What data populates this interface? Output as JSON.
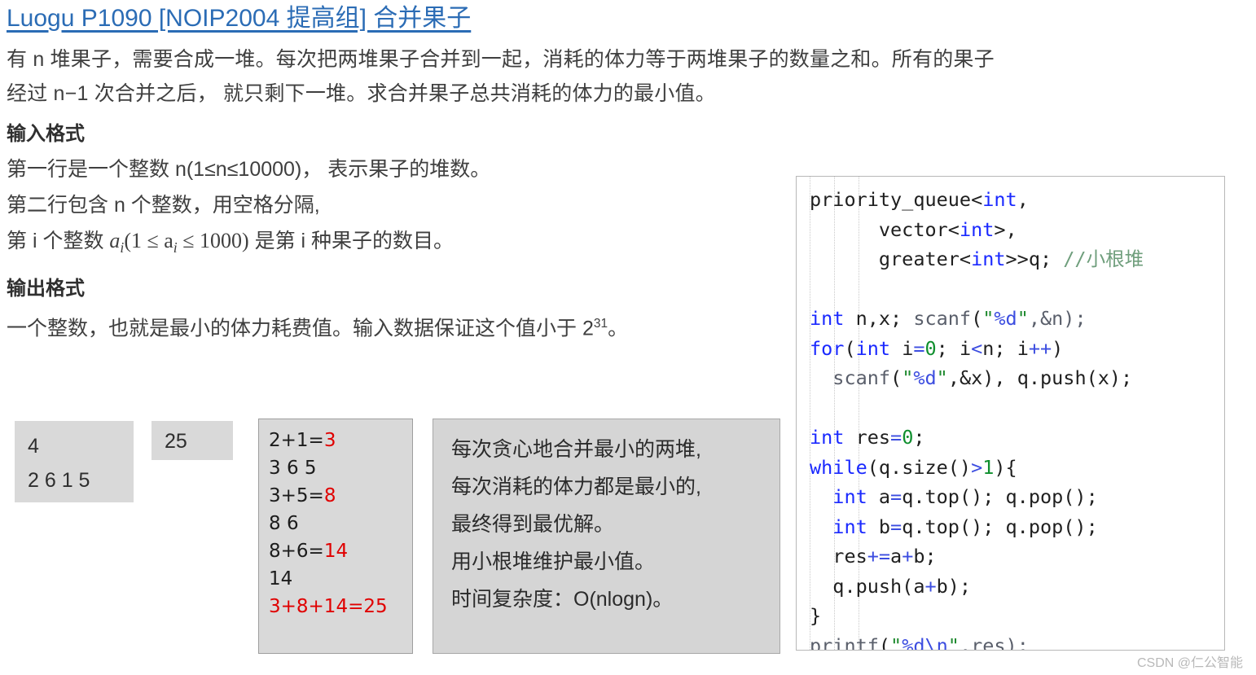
{
  "title": {
    "text": "Luogu P1090 [NOIP2004 提高组] 合并果子",
    "color": "#2b6cb5"
  },
  "problem": {
    "description_line1": "有 n 堆果子，需要合成一堆。每次把两堆果子合并到一起，消耗的体力等于两堆果子的数量之和。所有的果子",
    "description_line2": "经过 n−1 次合并之后， 就只剩下一堆。求合并果子总共消耗的体力的最小值。",
    "input_heading": "输入格式",
    "input_line1": "第一行是一个整数 n(1≤n≤10000)， 表示果子的堆数。",
    "input_line2": "第二行包含 n 个整数，用空格分隔,",
    "input_line3_pre": "第 i 个整数 ",
    "input_line3_math_a": "a",
    "input_line3_math_sub": "i",
    "input_line3_math_range": "(1 ≤ a",
    "input_line3_math_sub2": "i",
    "input_line3_math_range2": " ≤ 1000)",
    "input_line3_post": " 是第 i 种果子的数目。",
    "output_heading": "输出格式",
    "output_line_pre": "一个整数，也就是最小的体力耗费值。输入数据保证这个值小于 2",
    "output_line_sup": "31",
    "output_line_post": "。"
  },
  "samples": {
    "input_n": "4",
    "input_values": "2 6 1 5",
    "output_value": "25"
  },
  "trace": {
    "lines": [
      {
        "plain": "2+1=",
        "red": "3"
      },
      {
        "plain": "3 6 5",
        "red": ""
      },
      {
        "plain": "3+5=",
        "red": "8"
      },
      {
        "plain": "8 6",
        "red": ""
      },
      {
        "plain": "8+6=",
        "red": "14"
      },
      {
        "plain": "14",
        "red": ""
      },
      {
        "plain": "",
        "red": "3+8+14=25",
        "all_red": true
      }
    ]
  },
  "note": {
    "lines": [
      "每次贪心地合并最小的两堆,",
      "每次消耗的体力都是最小的,",
      "最终得到最优解。",
      "用小根堆维护最小值。",
      "时间复杂度：O(nlogn)。"
    ]
  },
  "code": {
    "lines": [
      [
        {
          "t": "priority_queue<",
          "c": "pl"
        },
        {
          "t": "int",
          "c": "kw"
        },
        {
          "t": ",",
          "c": "pl"
        }
      ],
      [
        {
          "t": "      vector<",
          "c": "pl"
        },
        {
          "t": "int",
          "c": "kw"
        },
        {
          "t": ">,",
          "c": "pl"
        }
      ],
      [
        {
          "t": "      greater<",
          "c": "pl"
        },
        {
          "t": "int",
          "c": "kw"
        },
        {
          "t": ">>q; ",
          "c": "pl"
        },
        {
          "t": "//小根堆",
          "c": "cmt"
        }
      ],
      [
        {
          "t": "",
          "c": "pl"
        }
      ],
      [
        {
          "t": "int",
          "c": "kw"
        },
        {
          "t": " n,x; ",
          "c": "pl"
        },
        {
          "t": "scanf",
          "c": "fn"
        },
        {
          "t": "(",
          "c": "pl"
        },
        {
          "t": "\"",
          "c": "str"
        },
        {
          "t": "%d",
          "c": "fmt"
        },
        {
          "t": "\"",
          "c": "str"
        },
        {
          "t": ",&n);",
          "c": "fn"
        }
      ],
      [
        {
          "t": "for",
          "c": "kw"
        },
        {
          "t": "(",
          "c": "pl"
        },
        {
          "t": "int",
          "c": "kw"
        },
        {
          "t": " i",
          "c": "pl"
        },
        {
          "t": "=",
          "c": "op"
        },
        {
          "t": "0",
          "c": "num"
        },
        {
          "t": "; i",
          "c": "pl"
        },
        {
          "t": "<",
          "c": "op"
        },
        {
          "t": "n; i",
          "c": "pl"
        },
        {
          "t": "++",
          "c": "op"
        },
        {
          "t": ")",
          "c": "pl"
        }
      ],
      [
        {
          "t": "  ",
          "c": "pl"
        },
        {
          "t": "scanf",
          "c": "fn"
        },
        {
          "t": "(",
          "c": "pl"
        },
        {
          "t": "\"",
          "c": "str"
        },
        {
          "t": "%d",
          "c": "fmt"
        },
        {
          "t": "\"",
          "c": "str"
        },
        {
          "t": ",&x), q.push(x);",
          "c": "pl"
        }
      ],
      [
        {
          "t": "",
          "c": "pl"
        }
      ],
      [
        {
          "t": "int",
          "c": "kw"
        },
        {
          "t": " res",
          "c": "pl"
        },
        {
          "t": "=",
          "c": "op"
        },
        {
          "t": "0",
          "c": "num"
        },
        {
          "t": ";",
          "c": "pl"
        }
      ],
      [
        {
          "t": "while",
          "c": "kw"
        },
        {
          "t": "(q.size()",
          "c": "pl"
        },
        {
          "t": ">",
          "c": "op"
        },
        {
          "t": "1",
          "c": "num"
        },
        {
          "t": "){",
          "c": "pl"
        }
      ],
      [
        {
          "t": "  ",
          "c": "pl"
        },
        {
          "t": "int",
          "c": "kw"
        },
        {
          "t": " a",
          "c": "pl"
        },
        {
          "t": "=",
          "c": "op"
        },
        {
          "t": "q.top(); q.pop();",
          "c": "pl"
        }
      ],
      [
        {
          "t": "  ",
          "c": "pl"
        },
        {
          "t": "int",
          "c": "kw"
        },
        {
          "t": " b",
          "c": "pl"
        },
        {
          "t": "=",
          "c": "op"
        },
        {
          "t": "q.top(); q.pop();",
          "c": "pl"
        }
      ],
      [
        {
          "t": "  res",
          "c": "pl"
        },
        {
          "t": "+=",
          "c": "op"
        },
        {
          "t": "a",
          "c": "pl"
        },
        {
          "t": "+",
          "c": "op"
        },
        {
          "t": "b;",
          "c": "pl"
        }
      ],
      [
        {
          "t": "  q.push(a",
          "c": "pl"
        },
        {
          "t": "+",
          "c": "op"
        },
        {
          "t": "b);",
          "c": "pl"
        }
      ],
      [
        {
          "t": "}",
          "c": "pl"
        }
      ],
      [
        {
          "t": "printf",
          "c": "fn"
        },
        {
          "t": "(",
          "c": "pl"
        },
        {
          "t": "\"",
          "c": "str"
        },
        {
          "t": "%d\\n",
          "c": "fmt"
        },
        {
          "t": "\"",
          "c": "str"
        },
        {
          "t": ",res);",
          "c": "fn"
        }
      ]
    ]
  },
  "watermark": "CSDN @仁公智能"
}
